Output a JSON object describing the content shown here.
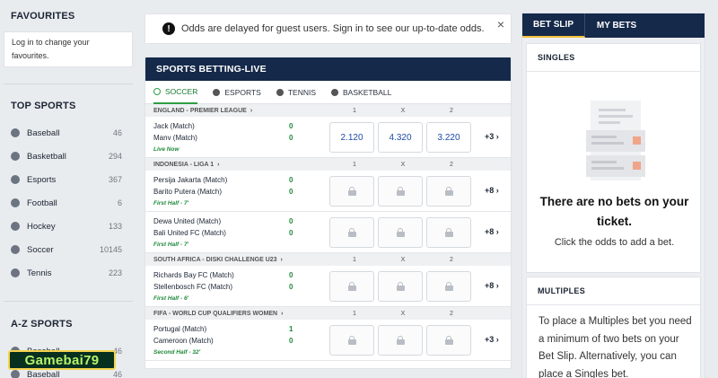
{
  "sidebar": {
    "favourites_title": "FAVOURITES",
    "favourites_text": "Log in to change your favourites.",
    "top_sports_title": "TOP SPORTS",
    "top_sports": [
      {
        "label": "Baseball",
        "count": "46",
        "icon": "baseball-icon"
      },
      {
        "label": "Basketball",
        "count": "294",
        "icon": "basketball-icon"
      },
      {
        "label": "Esports",
        "count": "367",
        "icon": "headset-icon"
      },
      {
        "label": "Football",
        "count": "6",
        "icon": "football-icon"
      },
      {
        "label": "Hockey",
        "count": "133",
        "icon": "hockey-icon"
      },
      {
        "label": "Soccer",
        "count": "10145",
        "icon": "soccer-icon"
      },
      {
        "label": "Tennis",
        "count": "223",
        "icon": "tennis-icon"
      }
    ],
    "az_title": "A-Z SPORTS",
    "az_sports": [
      {
        "label": "Baseball",
        "count": "46"
      },
      {
        "label": "Baseball",
        "count": "46"
      }
    ],
    "watermark": "Gamebai79"
  },
  "notice": {
    "text": "Odds are delayed for guest users. Sign in to see our up-to-date odds.",
    "close": "×"
  },
  "live": {
    "title": "SPORTS BETTING-LIVE",
    "tabs": [
      "SOCCER",
      "ESPORTS",
      "TENNIS",
      "BASKETBALL"
    ],
    "cols": [
      "1",
      "X",
      "2"
    ],
    "leagues": [
      {
        "name": "ENGLAND - PREMIER LEAGUE",
        "matches": [
          {
            "team1": "Jack (Match)",
            "team2": "Manv (Match)",
            "score1": "0",
            "score2": "0",
            "status": "Live Now",
            "odds": [
              "2.120",
              "4.320",
              "3.220"
            ],
            "more": "+3"
          }
        ]
      },
      {
        "name": "INDONESIA - LIGA 1",
        "matches": [
          {
            "team1": "Persija Jakarta (Match)",
            "team2": "Barito Putera (Match)",
            "score1": "0",
            "score2": "0",
            "status": "First Half - 7'",
            "odds": null,
            "more": "+8"
          },
          {
            "team1": "Dewa United (Match)",
            "team2": "Bali United FC (Match)",
            "score1": "0",
            "score2": "0",
            "status": "First Half - 7'",
            "odds": null,
            "more": "+8"
          }
        ]
      },
      {
        "name": "SOUTH AFRICA - DISKI CHALLENGE U23",
        "matches": [
          {
            "team1": "Richards Bay FC (Match)",
            "team2": "Stellenbosch FC (Match)",
            "score1": "0",
            "score2": "0",
            "status": "First Half - 6'",
            "odds": null,
            "more": "+8"
          }
        ]
      },
      {
        "name": "FIFA - WORLD CUP QUALIFIERS WOMEN",
        "matches": [
          {
            "team1": "Portugal (Match)",
            "team2": "Cameroon (Match)",
            "score1": "1",
            "score2": "0",
            "status": "Second Half - 32'",
            "odds": null,
            "more": "+3"
          }
        ]
      }
    ]
  },
  "betslip": {
    "tab_active": "BET SLIP",
    "tab_other": "MY BETS",
    "singles_title": "SINGLES",
    "empty_heading": "There are no bets on your ticket.",
    "empty_sub": "Click the odds to add a bet.",
    "multiples_title": "MULTIPLES",
    "multiples_text": "To place a Multiples bet you need a minimum of two bets on your Bet Slip. Alternatively, you can place a Singles bet."
  },
  "colors": {
    "navy": "#15294a",
    "green": "#2f9e44",
    "odds_blue": "#1c4aa6",
    "gold": "#f0c33c"
  }
}
